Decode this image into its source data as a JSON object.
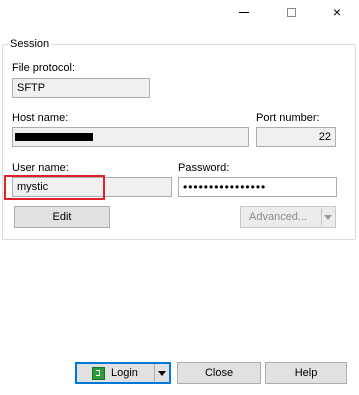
{
  "window": {
    "minimize_glyph": "minimize-icon",
    "maximize_glyph": "maximize-icon",
    "close_glyph": "×"
  },
  "session": {
    "legend": "Session",
    "file_protocol": {
      "label": "File protocol:",
      "value": "SFTP"
    },
    "host_name": {
      "label": "Host name:",
      "value": "(redacted)"
    },
    "port_number": {
      "label": "Port number:",
      "value": "22"
    },
    "user_name": {
      "label": "User name:",
      "value": "mystic"
    },
    "password": {
      "label": "Password:",
      "value": "••••••••••••••••"
    },
    "edit_button": "Edit",
    "advanced_button": "Advanced..."
  },
  "footer": {
    "login_button": "Login",
    "close_button": "Close",
    "help_button": "Help"
  },
  "colors": {
    "highlight": "#e0202a",
    "default_button_border": "#0078d7",
    "login_icon": "#2a9d3a"
  }
}
